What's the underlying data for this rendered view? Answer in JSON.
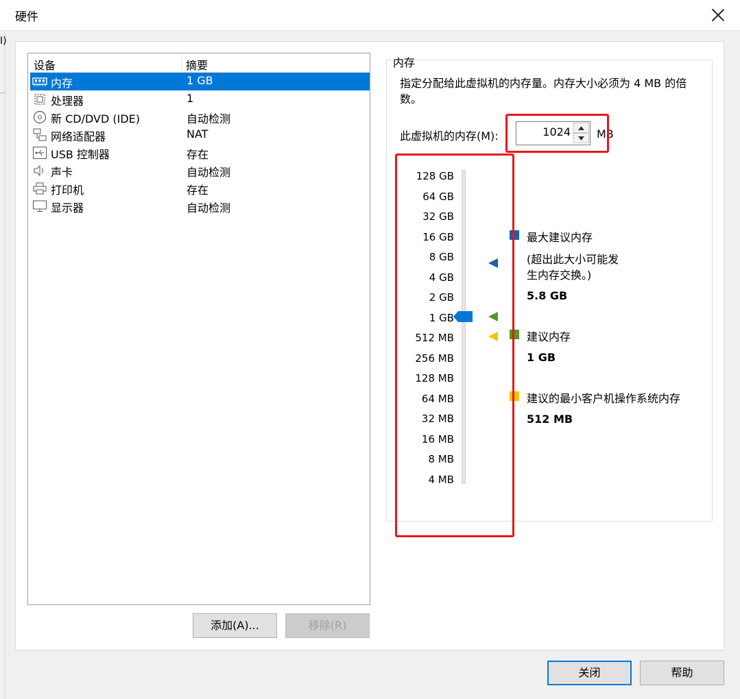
{
  "window": {
    "title": "硬件",
    "left_fragment": "I)"
  },
  "device_list": {
    "headers": {
      "device": "设备",
      "summary": "摘要"
    },
    "rows": [
      {
        "icon": "memory-icon",
        "name": "内存",
        "value": "1 GB",
        "selected": true
      },
      {
        "icon": "processor-icon",
        "name": "处理器",
        "value": "1"
      },
      {
        "icon": "cd-dvd-icon",
        "name": "新 CD/DVD (IDE)",
        "value": "自动检测"
      },
      {
        "icon": "network-adapter-icon",
        "name": "网络适配器",
        "value": "NAT"
      },
      {
        "icon": "usb-icon",
        "name": "USB 控制器",
        "value": "存在"
      },
      {
        "icon": "sound-icon",
        "name": "声卡",
        "value": "自动检测"
      },
      {
        "icon": "printer-icon",
        "name": "打印机",
        "value": "存在"
      },
      {
        "icon": "display-icon",
        "name": "显示器",
        "value": "自动检测"
      }
    ]
  },
  "buttons": {
    "add": "添加(A)...",
    "remove": "移除(R)",
    "close": "关闭",
    "help": "帮助"
  },
  "memory": {
    "group_title": "内存",
    "description": "指定分配给此虚拟机的内存量。内存大小必须为 4 MB 的倍数。",
    "field_label": "此虚拟机的内存(M):",
    "value": "1024",
    "unit": "MB",
    "scale_ticks": [
      "128 GB",
      "64 GB",
      "32 GB",
      "16 GB",
      "8 GB",
      "4 GB",
      "2 GB",
      "1 GB",
      "512 MB",
      "256 MB",
      "128 MB",
      "64 MB",
      "32 MB",
      "16 MB",
      "8 MB",
      "4 MB"
    ],
    "slider_value": "1 GB",
    "max_recommended": {
      "label": "最大建议内存",
      "note": "(超出此大小可能发生内存交换。)",
      "value": "5.8 GB",
      "color": "#1f5fa5"
    },
    "recommended": {
      "label": "建议内存",
      "value": "1 GB",
      "color": "#4f9a20"
    },
    "min_recommended": {
      "label": "建议的最小客户机操作系统内存",
      "value": "512 MB",
      "color": "#f5c400"
    }
  },
  "colors": {
    "selection": "#0078d7",
    "highlight_box": "#e8161b"
  }
}
